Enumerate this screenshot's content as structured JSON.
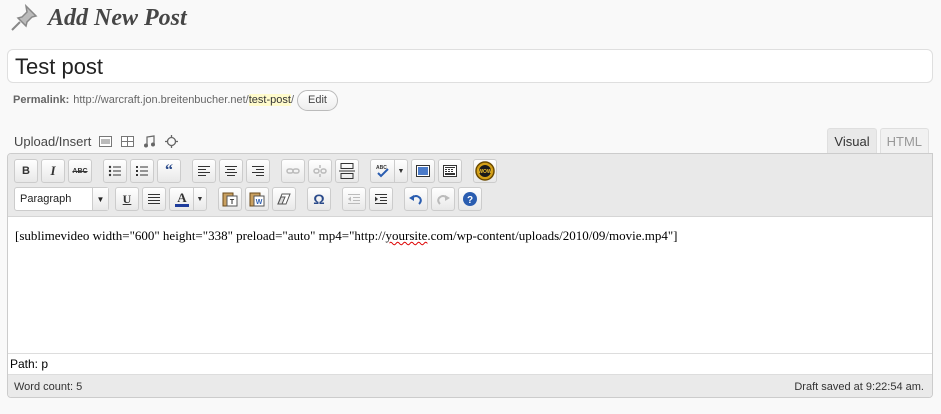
{
  "page": {
    "title": "Add New Post",
    "icon": "pushpin-icon"
  },
  "post": {
    "title_value": "Test post"
  },
  "permalink": {
    "label": "Permalink:",
    "base_url": "http://warcraft.jon.breitenbucher.net/",
    "slug": "test-post",
    "trailing": "/",
    "edit_label": "Edit"
  },
  "media": {
    "label": "Upload/Insert",
    "icons": [
      "image-icon",
      "video-icon",
      "audio-icon",
      "media-icon"
    ]
  },
  "editor_tabs": [
    {
      "label": "Visual",
      "active": true
    },
    {
      "label": "HTML",
      "active": false
    }
  ],
  "toolbar": {
    "format_select": "Paragraph",
    "row1_icons": [
      "bold-icon",
      "italic-icon",
      "strikethrough-icon",
      "bullet-list-icon",
      "numbered-list-icon",
      "blockquote-icon",
      "align-left-icon",
      "align-center-icon",
      "align-right-icon",
      "link-icon",
      "unlink-icon",
      "more-tag-icon",
      "spellcheck-icon",
      "fullscreen-icon",
      "kitchen-sink-icon",
      "wow-icon"
    ],
    "row2_icons": [
      "underline-icon",
      "justify-icon",
      "text-color-icon",
      "paste-text-icon",
      "paste-word-icon",
      "remove-format-icon",
      "special-char-icon",
      "outdent-icon",
      "indent-icon",
      "undo-icon",
      "redo-icon",
      "help-icon"
    ],
    "bold_label": "B",
    "italic_label": "I",
    "strike_label": "ABC",
    "underline_label": "U",
    "text_color_label": "A",
    "omega_label": "Ω",
    "wow_label": "WOW",
    "spell_label": "ABC"
  },
  "content": {
    "before": "[sublimevideo width=\"600\" height=\"338\" preload=\"auto\" mp4=\"http://",
    "misspelled": "yoursite",
    "after": ".com/wp-content/uploads/2010/09/movie.mp4\"]"
  },
  "path": {
    "text": "Path: p"
  },
  "status": {
    "word_count": "Word count: 5",
    "draft_saved": "Draft saved at 9:22:54 am."
  },
  "colors": {
    "background": "#f9f9f9",
    "toolbar": "#e9e9e9",
    "slug_highlight": "#fffbcc",
    "text_color_bar": "#1e3c9c"
  }
}
